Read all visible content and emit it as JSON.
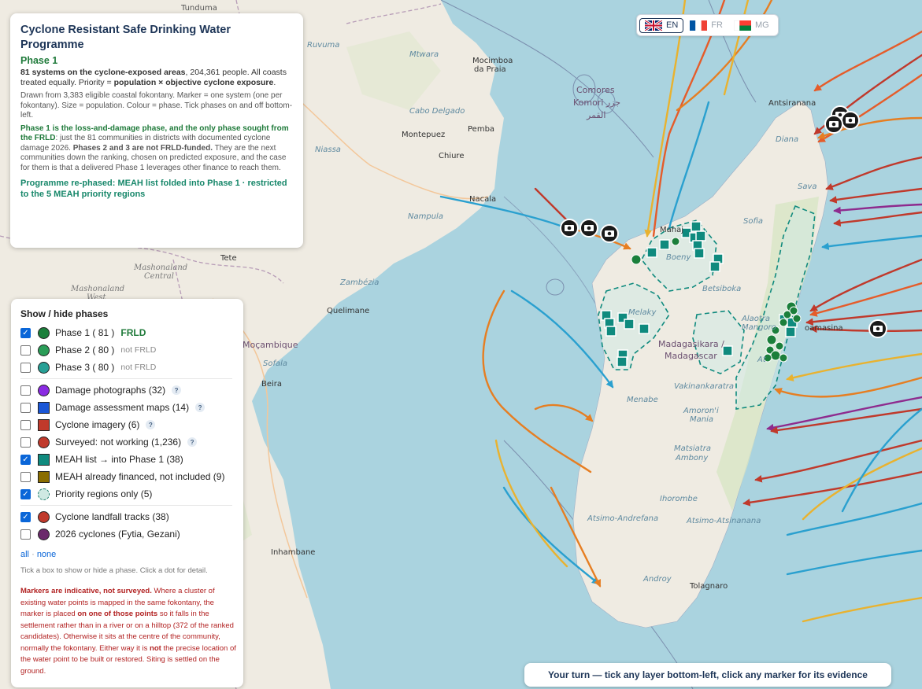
{
  "map": {
    "places": {
      "tunduma": "Tunduma",
      "ruvuma": "Ruvuma",
      "mtwara": "Mtwara",
      "mocimboa": "Mocimboa",
      "da_praia": "da Praia",
      "comores": "Comores",
      "komori": "Komori جزر",
      "alqamar": "القمر",
      "cabo_delgado": "Cabo Delgado",
      "montepuez": "Montepuez",
      "pemba": "Pemba",
      "niassa": "Niassa",
      "chiure": "Chiure",
      "nacala": "Nacala",
      "nampula": "Nampula",
      "antsiranana": "Antsiranana",
      "diana": "Diana",
      "sava": "Sava",
      "sofia": "Sofia",
      "mahajanga": "Mahaj",
      "boeny": "Boeny",
      "betsiboka": "Betsiboka",
      "tete": "Tete",
      "mashonaland_central_1": "Mashonaland",
      "mashonaland_central_2": "Central",
      "mashonaland_west_1": "Mashonaland",
      "mashonaland_west_2": "West",
      "zambezia": "Zambézia",
      "quelimane": "Quelimane",
      "mocambique": "Moçambique",
      "sofala": "Sofala",
      "beira": "Beira",
      "melaky": "Melaky",
      "alaotra_1": "Alaotra",
      "alaotra_2": "Mangoro",
      "toamasina": "oamasina",
      "madagasikara": "Madagasikara /",
      "madagascar": "Madagascar",
      "atsinanana": "At",
      "vakinankaratra": "Vakinankaratra",
      "menabe": "Menabe",
      "amoroni_1": "Amoron'i",
      "amoroni_2": "Mania",
      "matsiatra_1": "Matsiatra",
      "matsiatra_2": "Ambony",
      "ihorombe": "Ihorombe",
      "atsimo_andrefana": "Atsimo-Andrefana",
      "atsimo_atsinanana": "Atsimo-Atsinanana",
      "inhambane": "Inhambane",
      "androy": "Androy",
      "tolagnaro": "Tolagnaro"
    }
  },
  "language": {
    "options": [
      {
        "code": "EN",
        "active": true
      },
      {
        "code": "FR",
        "active": false
      },
      {
        "code": "MG",
        "active": false
      }
    ]
  },
  "info": {
    "title": "Cyclone Resistant Safe Drinking Water Programme",
    "phase": "Phase 1",
    "p1_bold": "81 systems on the cyclone-exposed areas",
    "p1_rest": ", 204,361 people. All coasts treated equally. Priority = ",
    "p1_bold2": "population × objective cyclone exposure",
    "p1_end": ".",
    "p2": "Drawn from 3,383 eligible coastal fokontany. Marker = one system (one per fokontany). Size = population. Colour = phase. Tick phases on and off bottom-left.",
    "p3_bold": "Phase 1 is the loss-and-damage phase, and the only phase sought from the FRLD",
    "p3_a": ": just the 81 communities in districts with documented cyclone damage 2026. ",
    "p3_bold2": "Phases 2 and 3 are not FRLD-funded.",
    "p3_b": " They are the next communities down the ranking, chosen on predicted exposure, and the case for them is that a delivered Phase 1 leverages other finance to reach them.",
    "p4": "Programme re-phased: MEAH list folded into Phase 1 · restricted to the 5 MEAH priority regions"
  },
  "layers": {
    "title": "Show / hide phases",
    "phases": [
      {
        "label": "Phase 1 (",
        "count": "81",
        "close": ")",
        "tag": "FRLD",
        "checked": true,
        "color": "#1b7f3b"
      },
      {
        "label": "Phase 2 (",
        "count": "80",
        "close": ")",
        "tag": "not FRLD",
        "checked": false,
        "color": "#2a9d58"
      },
      {
        "label": "Phase 3 (",
        "count": "80",
        "close": ")",
        "tag": "not FRLD",
        "checked": false,
        "color": "#27a096"
      }
    ],
    "evidence": [
      {
        "label": "Damage photographs (32)",
        "checked": false,
        "color": "#8a2be2",
        "shape": "dot",
        "help": "?"
      },
      {
        "label": "Damage assessment maps (14)",
        "checked": false,
        "color": "#1a56d6",
        "shape": "square",
        "help": "?"
      },
      {
        "label": "Cyclone imagery (6)",
        "checked": false,
        "color": "#c0392b",
        "shape": "square",
        "help": "?"
      },
      {
        "label": "Surveyed: not working (1,236)",
        "checked": false,
        "color": "#c0392b",
        "shape": "dot",
        "help": "?"
      },
      {
        "label": "MEAH list → into Phase 1 (38)",
        "checked": true,
        "color": "#0f8a7e",
        "shape": "square",
        "help": ""
      },
      {
        "label": "MEAH already financed, not included (9)",
        "checked": false,
        "color": "#8a6d00",
        "shape": "square",
        "help": ""
      },
      {
        "label": "Priority regions only (5)",
        "checked": true,
        "color": "#cfe9e3",
        "shape": "dashed",
        "help": ""
      }
    ],
    "tracks": [
      {
        "label": "Cyclone landfall tracks (38)",
        "checked": true,
        "color": "#c0392b"
      },
      {
        "label": "2026 cyclones (Fytia, Gezani)",
        "checked": false,
        "color": "#6b2a6b"
      }
    ],
    "link_all": "all",
    "link_sep": "·",
    "link_none": "none",
    "hint": "Tick a box to show or hide a phase. Click a dot for detail.",
    "warn_bold": "Markers are indicative, not surveyed.",
    "warn_a": " Where a cluster of existing water points is mapped in the same fokontany, the marker is placed ",
    "warn_bold2": "on one of those points",
    "warn_b": " so it falls in the settlement rather than in a river or on a hilltop (372 of the ranked candidates). Otherwise it sits at the centre of the community, normally the fokontany. Either way it is ",
    "warn_bold3": "not",
    "warn_c": " the precise location of the water point to be built or restored. Siting is settled on the ground."
  },
  "banner": "Your turn — tick any layer bottom-left, click any marker for its evidence"
}
